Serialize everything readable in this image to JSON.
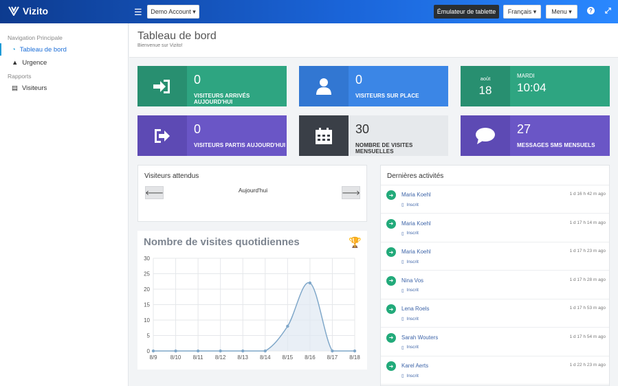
{
  "app": {
    "name": "Vizito"
  },
  "topbar": {
    "account_label": "Demo Account",
    "tablet_label": "Émulateur de tablette",
    "language_label": "Français",
    "menu_label": "Menu",
    "help_icon": "?",
    "expand_icon": "expand-icon"
  },
  "sidebar": {
    "section_nav": "Navigation Principale",
    "items_nav": [
      {
        "label": "Tableau de bord",
        "icon": "dashboard-icon"
      },
      {
        "label": "Urgence",
        "icon": "warning-icon"
      }
    ],
    "section_reports": "Rapports",
    "items_reports": [
      {
        "label": "Visiteurs",
        "icon": "book-icon"
      }
    ]
  },
  "header": {
    "title": "Tableau de bord",
    "subtitle": "Bienvenue sur Vizito!"
  },
  "cards": [
    {
      "value": "0",
      "label": "VISITEURS ARRIVÉS AUJOURD'HUI",
      "color": "#2ea581",
      "icon": "sign-in-icon"
    },
    {
      "value": "0",
      "label": "VISITEURS SUR PLACE",
      "color": "#3b86e6",
      "icon": "user-icon"
    },
    {
      "month": "août",
      "day": "18",
      "weekday": "MARDI",
      "time": "10:04",
      "color": "#2ea581"
    },
    {
      "value": "0",
      "label": "VISITEURS PARTIS AUJOURD'HUI",
      "color": "#6a56c6",
      "icon": "sign-out-icon"
    },
    {
      "value": "30",
      "label": "NOMBRE DE VISITES MENSUELLES",
      "color": "#3a3f47",
      "icon": "calendar-icon"
    },
    {
      "value": "27",
      "label": "MESSAGES SMS MENSUELS",
      "color": "#6a56c6",
      "icon": "comment-icon"
    }
  ],
  "expected": {
    "title": "Visiteurs attendus",
    "date_label": "Aujourd'hui"
  },
  "daily_chart": {
    "title": "Nombre de visites quotidiennes",
    "icon": "trophy-icon"
  },
  "chart_data": {
    "type": "line",
    "categories": [
      "8/9",
      "8/10",
      "8/11",
      "8/12",
      "8/13",
      "8/14",
      "8/15",
      "8/16",
      "8/17",
      "8/18"
    ],
    "values": [
      0,
      0,
      0,
      0,
      0,
      0,
      8,
      22,
      0,
      0
    ],
    "ylim": [
      0,
      30
    ],
    "yticks": [
      "0",
      "5",
      "10",
      "15",
      "20",
      "25",
      "30"
    ],
    "grid": true,
    "color": "#7fa7c9"
  },
  "activities": {
    "title": "Dernières activités",
    "items": [
      {
        "name": "Maria Koehl",
        "status": "Inscrit",
        "time": "1 d 16 h 42 m ago"
      },
      {
        "name": "Maria Koehl",
        "status": "Inscrit",
        "time": "1 d 17 h 14 m ago"
      },
      {
        "name": "Maria Koehl",
        "status": "Inscrit",
        "time": "1 d 17 h 23 m ago"
      },
      {
        "name": "Nina Vos",
        "status": "Inscrit",
        "time": "1 d 17 h 28 m ago"
      },
      {
        "name": "Lena Roels",
        "status": "Inscrit",
        "time": "1 d 17 h 53 m ago"
      },
      {
        "name": "Sarah Wouters",
        "status": "Inscrit",
        "time": "1 d 17 h 54 m ago"
      },
      {
        "name": "Karel Aerts",
        "status": "Inscrit",
        "time": "1 d 22 h 23 m ago"
      }
    ]
  }
}
